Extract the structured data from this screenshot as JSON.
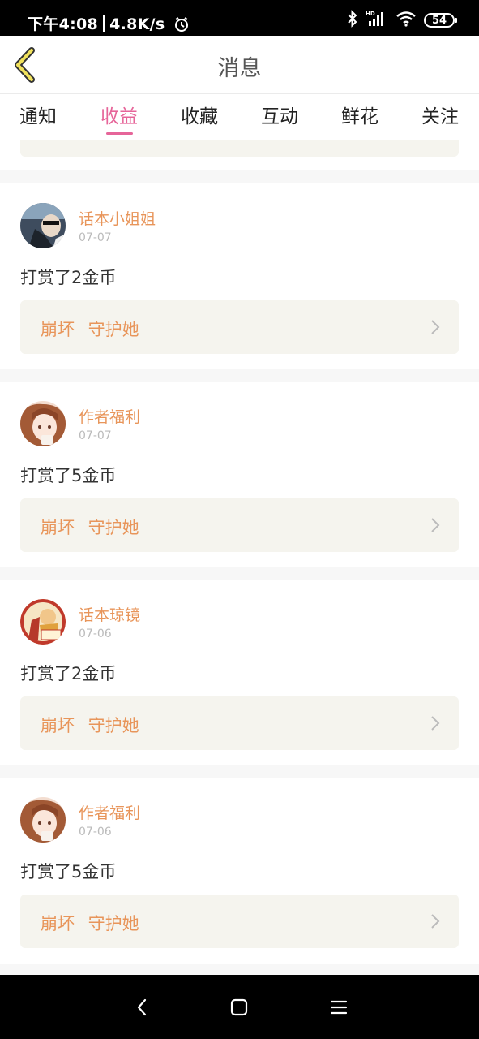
{
  "status_bar": {
    "time": "下午4:08",
    "speed": "4.8K/s",
    "battery": "54",
    "icons": [
      "alarm-icon",
      "bluetooth-icon",
      "signal-icon",
      "wifi-icon",
      "battery-icon"
    ]
  },
  "header": {
    "title": "消息",
    "back_icon": "chevron-left-icon"
  },
  "tabs": [
    {
      "label": "通知",
      "active": false
    },
    {
      "label": "收益",
      "active": true
    },
    {
      "label": "收藏",
      "active": false
    },
    {
      "label": "互动",
      "active": false
    },
    {
      "label": "鲜花",
      "active": false
    },
    {
      "label": "关注",
      "active": false
    }
  ],
  "messages": [
    {
      "author": "话本小姐姐",
      "date": "07-07",
      "text": "打赏了2金币",
      "link": "崩坏 守护她"
    },
    {
      "author": "作者福利",
      "date": "07-07",
      "text": "打赏了5金币",
      "link": "崩坏 守护她"
    },
    {
      "author": "话本琼镜",
      "date": "07-06",
      "text": "打赏了2金币",
      "link": "崩坏 守护她"
    },
    {
      "author": "作者福利",
      "date": "07-06",
      "text": "打赏了5金币",
      "link": "崩坏 守护她"
    }
  ],
  "bottom_nav": [
    "back-icon",
    "home-icon",
    "menu-icon"
  ],
  "colors": {
    "accent": "#e66599",
    "author": "#e8955a",
    "link_bg": "#f5f4ee"
  }
}
